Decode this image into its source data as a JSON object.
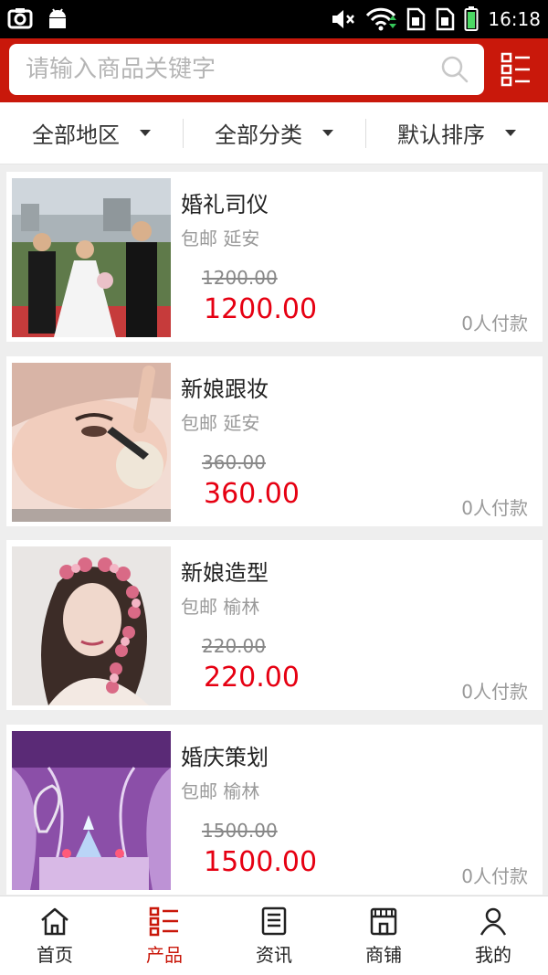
{
  "status_bar": {
    "time": "16:18",
    "icons": [
      "screenshot-icon",
      "android-icon",
      "mute-icon",
      "wifi-icon",
      "sim1-icon",
      "sim2-icon",
      "battery-icon"
    ]
  },
  "search": {
    "placeholder": "请输入商品关键字",
    "value": ""
  },
  "colors": {
    "brand": "#c9180b",
    "price": "#e60012"
  },
  "filters": [
    {
      "label": "全部地区"
    },
    {
      "label": "全部分类"
    },
    {
      "label": "默认排序"
    }
  ],
  "products": [
    {
      "name": "婚礼司仪",
      "shipping": "包邮 延安",
      "original_price": "1200.00",
      "price": "1200.00",
      "sales": "0人付款",
      "image": "wedding-ceremony-photo"
    },
    {
      "name": "新娘跟妆",
      "shipping": "包邮 延安",
      "original_price": "360.00",
      "price": "360.00",
      "sales": "0人付款",
      "image": "bridal-makeup-photo"
    },
    {
      "name": "新娘造型",
      "shipping": "包邮 榆林",
      "original_price": "220.00",
      "price": "220.00",
      "sales": "0人付款",
      "image": "bridal-hairstyle-photo"
    },
    {
      "name": "婚庆策划",
      "shipping": "包邮 榆林",
      "original_price": "1500.00",
      "price": "1500.00",
      "sales": "0人付款",
      "image": "wedding-planning-photo"
    }
  ],
  "nav": [
    {
      "label": "首页",
      "icon": "home-icon"
    },
    {
      "label": "产品",
      "icon": "product-list-icon",
      "active": true
    },
    {
      "label": "资讯",
      "icon": "news-icon"
    },
    {
      "label": "商铺",
      "icon": "shop-icon"
    },
    {
      "label": "我的",
      "icon": "user-icon"
    }
  ]
}
